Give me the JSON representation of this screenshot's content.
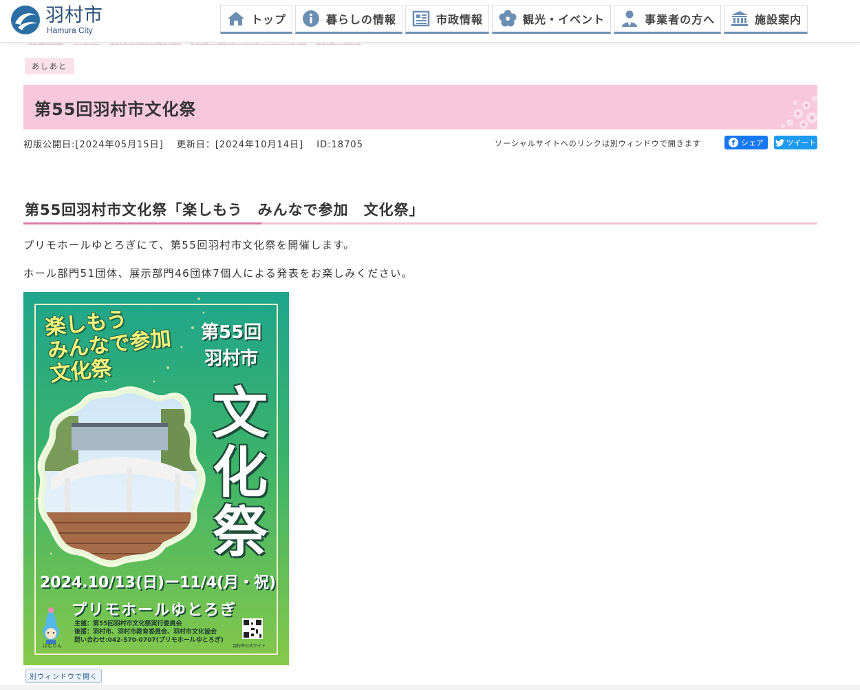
{
  "site": {
    "logo_ja": "羽村市",
    "logo_en": "Hamura City"
  },
  "nav": [
    {
      "label": "トップ",
      "icon": "home-icon"
    },
    {
      "label": "暮らしの情報",
      "icon": "info-icon"
    },
    {
      "label": "市政情報",
      "icon": "newspaper-icon"
    },
    {
      "label": "観光・イベント",
      "icon": "flower-icon"
    },
    {
      "label": "事業者の方へ",
      "icon": "person-icon"
    },
    {
      "label": "施設案内",
      "icon": "building-icon"
    }
  ],
  "breadcrumb": [
    "現在位置",
    "トップ",
    "羽村市教育委員会",
    "文化・芸術・スポーツ・学習",
    "文化・芸術"
  ],
  "tag": "あしあと",
  "page": {
    "title": "第55回羽村市文化祭",
    "published": "初版公開日:[2024年05月15日]",
    "updated": "更新日：[2024年10月14日]",
    "id": "ID:18705",
    "social_note": "ソーシャルサイトへのリンクは別ウィンドウで開きます",
    "share_fb": "シェア",
    "share_tw": "ツイート"
  },
  "article": {
    "heading": "第55回羽村市文化祭「楽しもう　みんなで参加　文化祭」",
    "p1": "プリモホールゆとろぎにて、第55回羽村市文化祭を開催します。",
    "p2": "ホール部門51団体、展示部門46団体7個人による発表をお楽しみください。",
    "open_new_window": "別ウィンドウで開く"
  },
  "poster": {
    "slogan_1": "楽しもう",
    "slogan_2": "みんなで参加",
    "slogan_3": "文化祭",
    "edition_1": "第55回",
    "edition_2": "羽村市",
    "big_1": "文",
    "big_2": "化",
    "big_3": "祭",
    "date": "2024.10/13(日)ー11/4(月・祝)",
    "venue": "プリモホールゆとろぎ",
    "info_1": "主催：第55回羽村市文化祭実行委員会",
    "info_2": "後援：羽村市、羽村市教育委員会、羽村市文化協会",
    "info_3": "問い合わせ:042-570-0707(プリモホールゆとろぎ)",
    "mascot_name": "はむりん",
    "qr_caption": "羽村市公式サイト"
  },
  "colors": {
    "title_bg": "#f7c8dc",
    "accent_pink": "#d97aa3",
    "nav_underline": "#6b8fb3",
    "facebook": "#1877f2",
    "twitter": "#1d9bf0"
  }
}
